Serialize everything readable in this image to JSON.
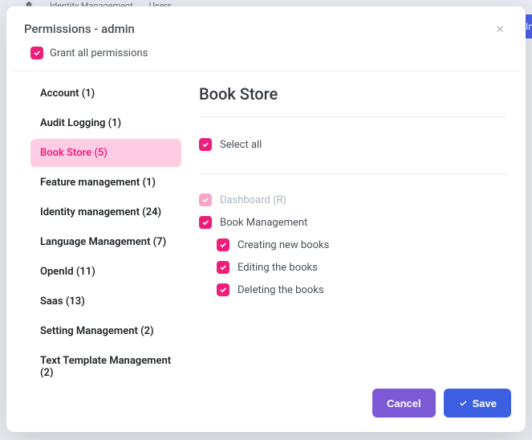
{
  "backdrop": {
    "breadcrumb1": "Identity Management",
    "breadcrumb2": "Users",
    "bgBtn": "Im"
  },
  "modal": {
    "title": "Permissions - admin",
    "grantAllLabel": "Grant all permissions",
    "grantAllChecked": true
  },
  "sidebar": {
    "items": [
      {
        "label": "Account (1)",
        "active": false
      },
      {
        "label": "Audit Logging (1)",
        "active": false
      },
      {
        "label": "Book Store (5)",
        "active": true
      },
      {
        "label": "Feature management (1)",
        "active": false
      },
      {
        "label": "Identity management (24)",
        "active": false
      },
      {
        "label": "Language Management (7)",
        "active": false
      },
      {
        "label": "OpenId (11)",
        "active": false
      },
      {
        "label": "Saas (13)",
        "active": false
      },
      {
        "label": "Setting Management (2)",
        "active": false
      },
      {
        "label": "Text Template Management (2)",
        "active": false
      }
    ]
  },
  "content": {
    "title": "Book Store",
    "selectAllLabel": "Select all",
    "selectAllChecked": true,
    "permissions": [
      {
        "label": "Dashboard (R)",
        "checked": true,
        "disabled": true,
        "children": []
      },
      {
        "label": "Book Management",
        "checked": true,
        "disabled": false,
        "children": [
          {
            "label": "Creating new books",
            "checked": true
          },
          {
            "label": "Editing the books",
            "checked": true
          },
          {
            "label": "Deleting the books",
            "checked": true
          }
        ]
      }
    ]
  },
  "footer": {
    "cancel": "Cancel",
    "save": "Save"
  }
}
